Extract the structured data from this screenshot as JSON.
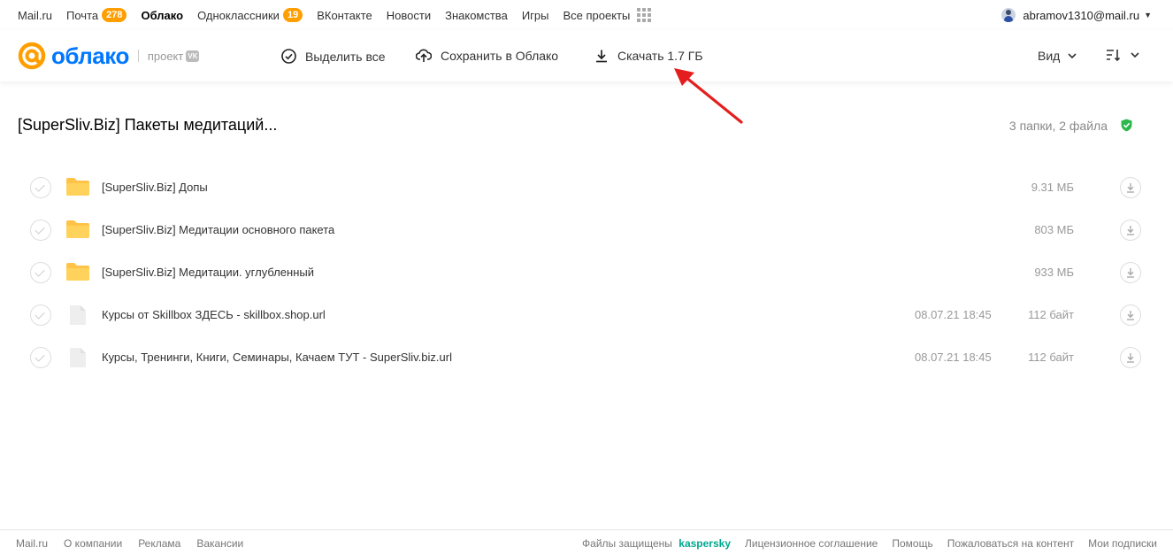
{
  "portal": {
    "links": [
      {
        "label": "Mail.ru",
        "badge": null,
        "active": false
      },
      {
        "label": "Почта",
        "badge": "278",
        "active": false
      },
      {
        "label": "Облако",
        "badge": null,
        "active": true
      },
      {
        "label": "Одноклассники",
        "badge": "19",
        "active": false
      },
      {
        "label": "ВКонтакте",
        "badge": null,
        "active": false
      },
      {
        "label": "Новости",
        "badge": null,
        "active": false
      },
      {
        "label": "Знакомства",
        "badge": null,
        "active": false
      },
      {
        "label": "Игры",
        "badge": null,
        "active": false
      },
      {
        "label": "Все проекты",
        "badge": null,
        "active": false
      }
    ],
    "user_email": "abramov1310@mail.ru",
    "badge_color": "#ff9e00"
  },
  "toolbar": {
    "logo_text": "облако",
    "logo_sub": "проект",
    "logo_vk": "VK",
    "select_all": "Выделить все",
    "save_to_cloud": "Сохранить в Облако",
    "download": "Скачать 1.7 ГБ",
    "view": "Вид",
    "brand_color": "#0077ff",
    "accent_color": "#ff9e00"
  },
  "folder": {
    "title": "[SuperSliv.Biz] Пакеты медитаций...",
    "count": "3 папки, 2 файла"
  },
  "items": [
    {
      "type": "folder",
      "name": "[SuperSliv.Biz] Допы",
      "date": "",
      "size": "9.31 МБ"
    },
    {
      "type": "folder",
      "name": "[SuperSliv.Biz] Медитации основного пакета",
      "date": "",
      "size": "803 МБ"
    },
    {
      "type": "folder",
      "name": "[SuperSliv.Biz] Медитации. углубленный",
      "date": "",
      "size": "933 МБ"
    },
    {
      "type": "file",
      "name": "Курсы от Skillbox ЗДЕСЬ - skillbox.shop.url",
      "date": "08.07.21 18:45",
      "size": "112 байт"
    },
    {
      "type": "file",
      "name": "Курсы, Тренинги, Книги, Семинары, Качаем ТУТ - SuperSliv.biz.url",
      "date": "08.07.21 18:45",
      "size": "112 байт"
    }
  ],
  "footer": {
    "left": [
      "Mail.ru",
      "О компании",
      "Реклама",
      "Вакансии"
    ],
    "protected_prefix": "Файлы защищены",
    "protected_brand": "kaspersky",
    "right": [
      "Лицензионное соглашение",
      "Помощь",
      "Пожаловаться на контент",
      "Мои подписки"
    ]
  }
}
